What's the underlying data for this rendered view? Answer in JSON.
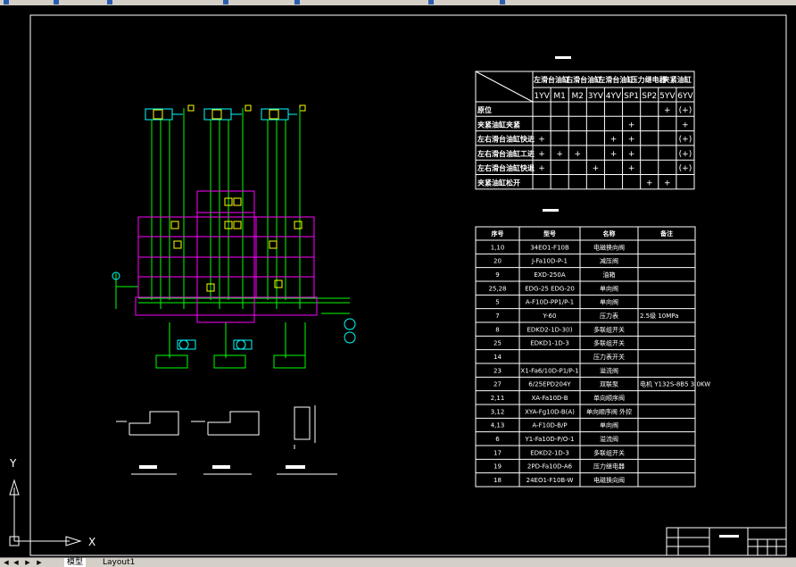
{
  "status_table": {
    "headers": [
      "左滑台油缸",
      "右滑台油缸",
      "左滑台油缸",
      "压力继电器",
      "夹紧油缸"
    ],
    "codes": [
      "1YV",
      "M1",
      "M2",
      "3YV",
      "4YV",
      "SP1",
      "SP2",
      "5YV",
      "6YV"
    ],
    "rows": [
      {
        "label": "原位",
        "cells": [
          "",
          "",
          "",
          "",
          "",
          "",
          "",
          "+",
          "(+)"
        ]
      },
      {
        "label": "夹紧油缸夹紧",
        "cells": [
          "",
          "",
          "",
          "",
          "",
          "+",
          "",
          "",
          "+"
        ]
      },
      {
        "label": "左右滑台油缸快进",
        "cells": [
          "+",
          "",
          "",
          "",
          "+",
          "+",
          "",
          "",
          "(+)"
        ]
      },
      {
        "label": "左右滑台油缸工进",
        "cells": [
          "+",
          "+",
          "+",
          "",
          "+",
          "+",
          "",
          "",
          "(+)"
        ]
      },
      {
        "label": "左右滑台油缸快退",
        "cells": [
          "+",
          "",
          "",
          "+",
          "",
          "+",
          "",
          "",
          "(+)"
        ]
      },
      {
        "label": "夹紧油缸松开",
        "cells": [
          "",
          "",
          "",
          "",
          "",
          "",
          "+",
          "+",
          ""
        ]
      }
    ]
  },
  "parts_table": {
    "headers": [
      "序号",
      "型号",
      "名称",
      "备注"
    ],
    "rows": [
      [
        "1,10",
        "34EO1-F10B",
        "电磁换向阀",
        ""
      ],
      [
        "20",
        "J-Fa10D-P-1",
        "减压阀",
        ""
      ],
      [
        "9",
        "EXD-250A",
        "油箱",
        ""
      ],
      [
        "25,28",
        "EDG-25  EDG-20",
        "单向阀",
        ""
      ],
      [
        "5",
        "A-F10D-PP1/P-1",
        "单向阀",
        ""
      ],
      [
        "7",
        "Y-60",
        "压力表",
        "2.5级 10MPa"
      ],
      [
        "8",
        "EDKD2-1D-3(I)",
        "多联组开关",
        ""
      ],
      [
        "25",
        "EDKD1-1D-3",
        "多联组开关",
        ""
      ],
      [
        "14",
        "",
        "压力表开关",
        ""
      ],
      [
        "23",
        "X1-Fa6/10D-P1/P-1",
        "溢流阀",
        ""
      ],
      [
        "27",
        "6/25EPD204Y",
        "双联泵",
        "电机 Y132S-8B5  3.0KW"
      ],
      [
        "2,11",
        "XA-Fa10D-B",
        "单向顺序阀",
        ""
      ],
      [
        "3,12",
        "XYA-Fg10D-B(A)",
        "单向顺序阀 外控",
        ""
      ],
      [
        "4,13",
        "A-F10D-B/P",
        "单向阀",
        ""
      ],
      [
        "6",
        "Y1-Fa10D-P/O-1",
        "溢流阀",
        ""
      ],
      [
        "17",
        "EDKD2-1D-3",
        "多联组开关",
        ""
      ],
      [
        "19",
        "2PD-Fa10D-A6",
        "压力继电器",
        ""
      ],
      [
        "18",
        "24EO1-F10B-W",
        "电磁换向阀",
        ""
      ]
    ]
  },
  "ucs": {
    "y_label": "Y",
    "x_label": "X"
  },
  "tabs": [
    "模型",
    "Layout1"
  ],
  "colors": {
    "cyan": "#00ffff",
    "magenta": "#ff00ff",
    "green": "#00ff00",
    "yellow": "#ffff00",
    "white": "#ffffff"
  }
}
